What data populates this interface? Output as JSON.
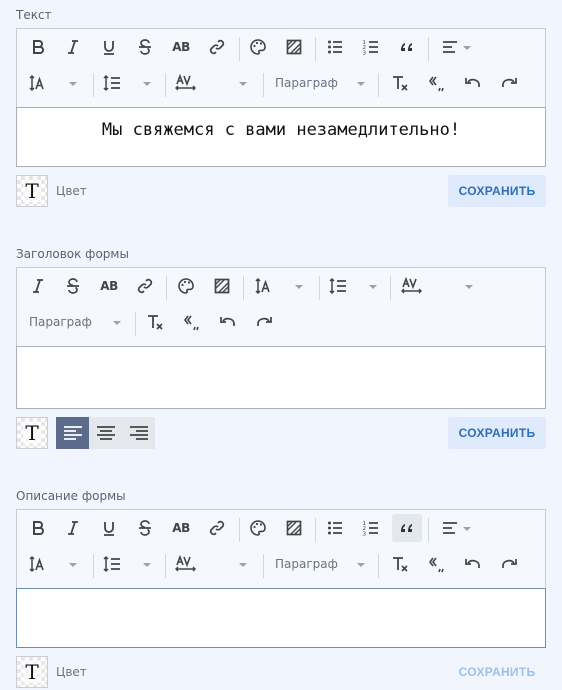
{
  "section1": {
    "label": "Текст",
    "paragraph_label": "Параграф",
    "text_value": "Мы свяжемся с вами незамедлительно!",
    "color_label": "Цвет",
    "save_label": "СОХРАНИТЬ",
    "strike_label": "AB"
  },
  "section2": {
    "label": "Заголовок формы",
    "paragraph_label": "Параграф",
    "save_label": "СОХРАНИТЬ",
    "strike_label": "AB",
    "text_value": ""
  },
  "section3": {
    "label": "Описание формы",
    "paragraph_label": "Параграф",
    "color_label": "Цвет",
    "save_label": "СОХРАНИТЬ",
    "strike_label": "AB",
    "text_value": ""
  },
  "colors": {
    "background": "#f1f6fe",
    "save_text": "#2e6fb8",
    "save_bg": "#dfeafc",
    "align_active": "#5b6b8c"
  }
}
